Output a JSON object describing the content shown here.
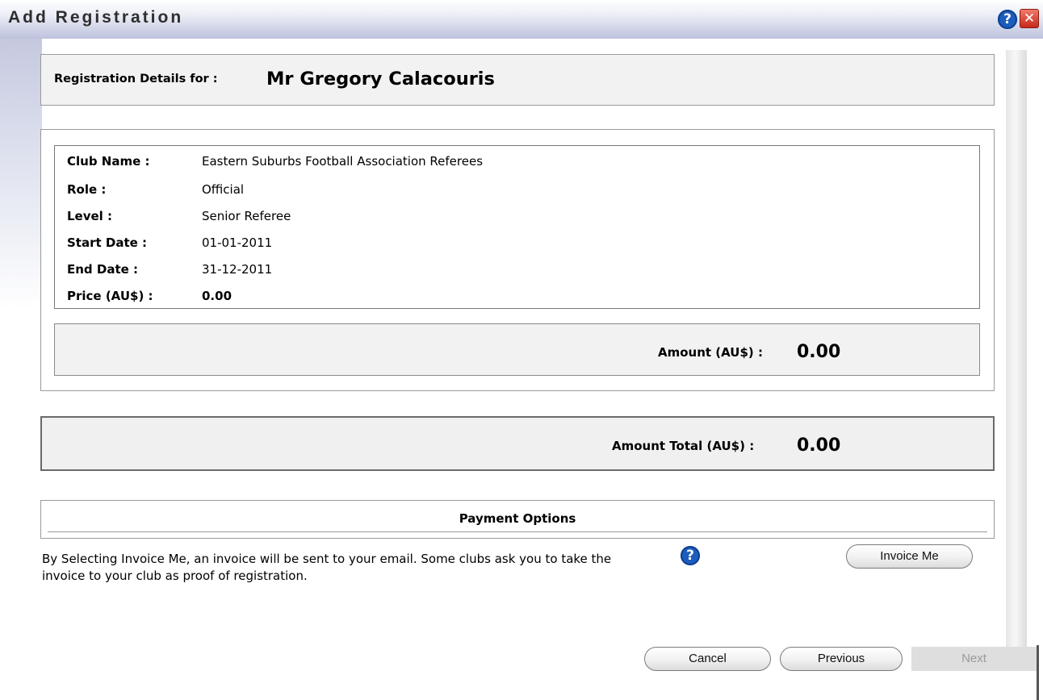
{
  "dialog": {
    "title": "Add Registration",
    "help_icon": "help-icon",
    "close_icon": "close-icon"
  },
  "header": {
    "label": "Registration Details for :",
    "name": "Mr Gregory Calacouris"
  },
  "details": [
    {
      "label": "Club Name :",
      "value": "Eastern Suburbs Football Association Referees"
    },
    {
      "label": "Role :",
      "value": "Official"
    },
    {
      "label": "Level :",
      "value": "Senior Referee"
    },
    {
      "label": "Start Date :",
      "value": "01-01-2011"
    },
    {
      "label": "End Date :",
      "value": "31-12-2011"
    },
    {
      "label": "Price (AU$) :",
      "value": "0.00"
    }
  ],
  "amount": {
    "label": "Amount (AU$) :",
    "value": "0.00"
  },
  "total": {
    "label": "Amount Total (AU$) :",
    "value": "0.00"
  },
  "payment": {
    "title": "Payment Options",
    "invoice_text": "By Selecting Invoice Me, an invoice will be sent to your email. Some clubs ask you to take the invoice to your club as proof of registration.",
    "invoice_button": "Invoice Me"
  },
  "nav": {
    "cancel": "Cancel",
    "previous": "Previous",
    "next": "Next"
  }
}
